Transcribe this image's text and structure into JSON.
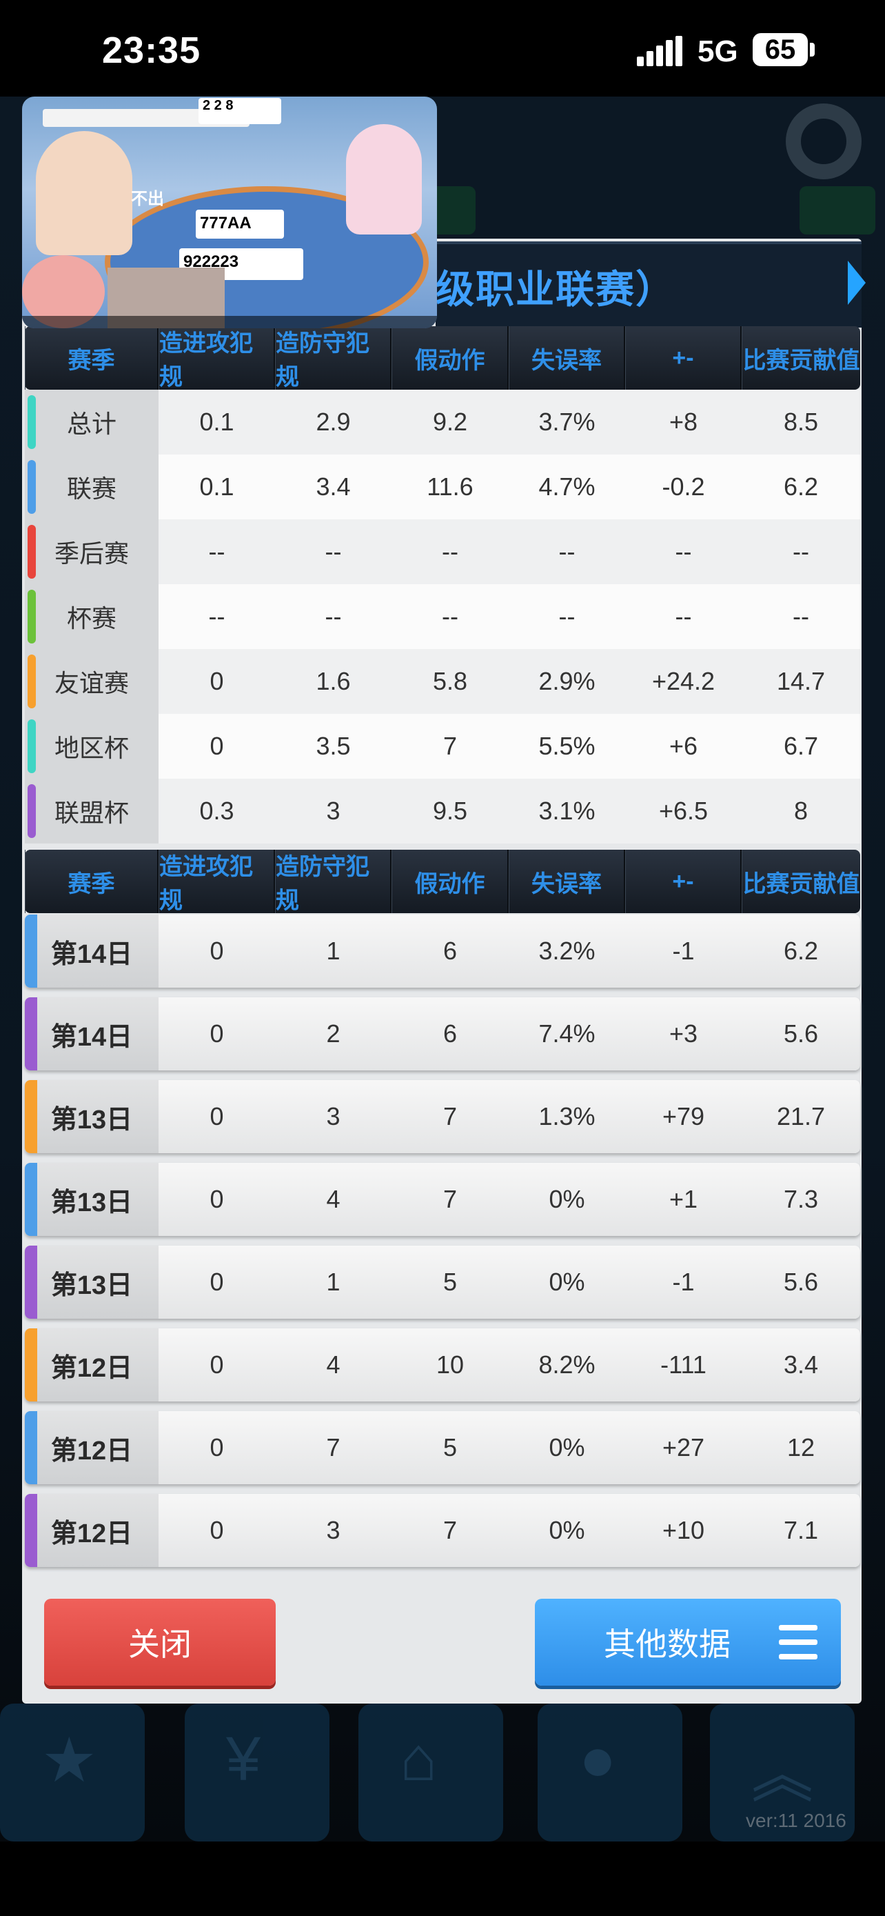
{
  "status_bar": {
    "time": "23:35",
    "network": "5G",
    "battery": "65"
  },
  "panel": {
    "title": "级职业联赛）"
  },
  "table": {
    "headers": [
      "赛季",
      "造进攻犯规",
      "造防守犯规",
      "假动作",
      "失误率",
      "+-",
      "比赛贡献值"
    ]
  },
  "summary_rows": [
    {
      "label": "总计",
      "color": "#3fd5c4",
      "values": [
        "0.1",
        "2.9",
        "9.2",
        "3.7%",
        "+8",
        "8.5"
      ]
    },
    {
      "label": "联赛",
      "color": "#4e9ee8",
      "values": [
        "0.1",
        "3.4",
        "11.6",
        "4.7%",
        "-0.2",
        "6.2"
      ]
    },
    {
      "label": "季后赛",
      "color": "#e8453c",
      "values": [
        "--",
        "--",
        "--",
        "--",
        "--",
        "--"
      ]
    },
    {
      "label": "杯赛",
      "color": "#6cc23a",
      "values": [
        "--",
        "--",
        "--",
        "--",
        "--",
        "--"
      ]
    },
    {
      "label": "友谊赛",
      "color": "#f7a02e",
      "values": [
        "0",
        "1.6",
        "5.8",
        "2.9%",
        "+24.2",
        "14.7"
      ]
    },
    {
      "label": "地区杯",
      "color": "#3fd5c4",
      "values": [
        "0",
        "3.5",
        "7",
        "5.5%",
        "+6",
        "6.7"
      ]
    },
    {
      "label": "联盟杯",
      "color": "#9a5cd0",
      "values": [
        "0.3",
        "3",
        "9.5",
        "3.1%",
        "+6.5",
        "8"
      ]
    }
  ],
  "game_rows": [
    {
      "label": "第14日",
      "color": "#4e9ee8",
      "values": [
        "0",
        "1",
        "6",
        "3.2%",
        "-1",
        "6.2"
      ]
    },
    {
      "label": "第14日",
      "color": "#9a5cd0",
      "values": [
        "0",
        "2",
        "6",
        "7.4%",
        "+3",
        "5.6"
      ]
    },
    {
      "label": "第13日",
      "color": "#f7a02e",
      "values": [
        "0",
        "3",
        "7",
        "1.3%",
        "+79",
        "21.7"
      ]
    },
    {
      "label": "第13日",
      "color": "#4e9ee8",
      "values": [
        "0",
        "4",
        "7",
        "0%",
        "+1",
        "7.3"
      ]
    },
    {
      "label": "第13日",
      "color": "#9a5cd0",
      "values": [
        "0",
        "1",
        "5",
        "0%",
        "-1",
        "5.6"
      ]
    },
    {
      "label": "第12日",
      "color": "#f7a02e",
      "values": [
        "0",
        "4",
        "10",
        "8.2%",
        "-111",
        "3.4"
      ]
    },
    {
      "label": "第12日",
      "color": "#4e9ee8",
      "values": [
        "0",
        "7",
        "5",
        "0%",
        "+27",
        "12"
      ]
    },
    {
      "label": "第12日",
      "color": "#9a5cd0",
      "values": [
        "0",
        "3",
        "7",
        "0%",
        "+10",
        "7.1"
      ]
    }
  ],
  "buttons": {
    "close": "关闭",
    "other": "其他数据"
  },
  "footer": {
    "version": "ver:11  2016"
  },
  "video_overlay": {
    "pass_text": "不出",
    "hand_top": "777AA",
    "hand_bottom": "922223",
    "top_cards": "2 2 8"
  }
}
